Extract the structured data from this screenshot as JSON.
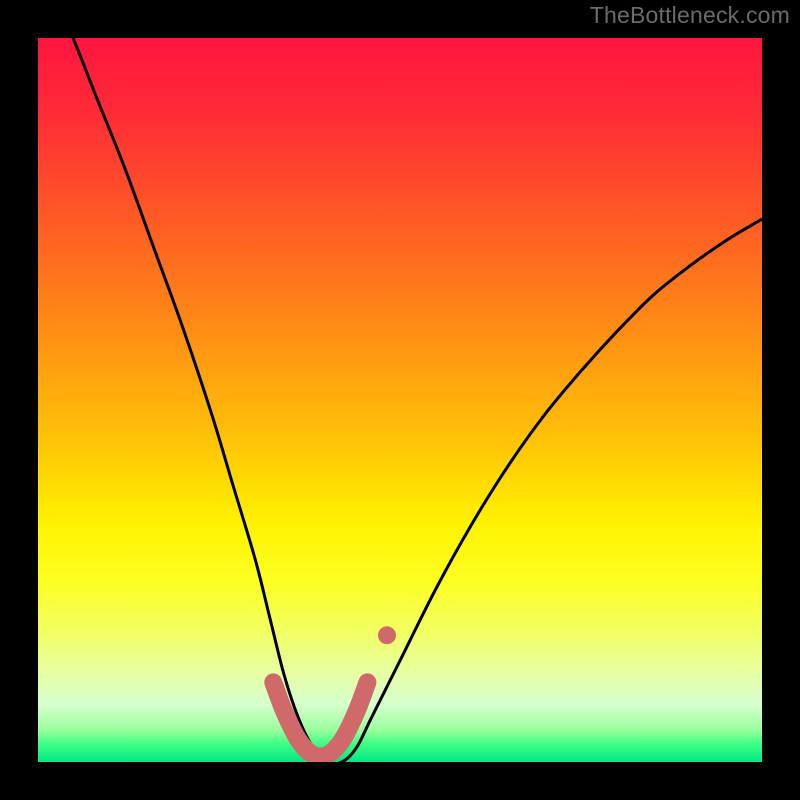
{
  "watermark": "TheBottleneck.com",
  "chart_data": {
    "type": "line",
    "title": "",
    "xlabel": "",
    "ylabel": "",
    "xlim": [
      0,
      100
    ],
    "ylim": [
      0,
      100
    ],
    "gradient_stops": [
      {
        "offset": 0.0,
        "color": "#ff153e"
      },
      {
        "offset": 0.1,
        "color": "#ff2a37"
      },
      {
        "offset": 0.25,
        "color": "#ff5a25"
      },
      {
        "offset": 0.4,
        "color": "#ff8c15"
      },
      {
        "offset": 0.55,
        "color": "#ffc108"
      },
      {
        "offset": 0.67,
        "color": "#fff200"
      },
      {
        "offset": 0.75,
        "color": "#fcff22"
      },
      {
        "offset": 0.82,
        "color": "#f2ff62"
      },
      {
        "offset": 0.88,
        "color": "#e6ffa6"
      },
      {
        "offset": 0.92,
        "color": "#d6ffce"
      },
      {
        "offset": 0.955,
        "color": "#9cff9e"
      },
      {
        "offset": 0.975,
        "color": "#3fff86"
      },
      {
        "offset": 1.0,
        "color": "#00e884"
      }
    ],
    "series": [
      {
        "name": "bottleneck-curve",
        "stroke": "#000000",
        "stroke_width": 3,
        "x": [
          0,
          4,
          8,
          12,
          16,
          20,
          24,
          27,
          30,
          32,
          34,
          36,
          38,
          40,
          42,
          44,
          46,
          50,
          55,
          60,
          65,
          70,
          75,
          80,
          85,
          90,
          95,
          100
        ],
        "y": [
          110,
          102,
          92,
          82,
          71,
          60,
          48,
          38,
          28,
          20,
          12,
          6,
          2,
          0,
          0,
          2,
          6,
          14,
          24,
          33,
          41,
          48,
          54,
          59.5,
          64.5,
          68.5,
          72,
          75
        ]
      },
      {
        "name": "highlight-band",
        "stroke": "#d06a6a",
        "stroke_width": 18,
        "linecap": "round",
        "x": [
          32.5,
          34,
          36,
          38,
          40,
          42,
          44,
          45.5
        ],
        "y": [
          11,
          7,
          3,
          1,
          1,
          3,
          7,
          11
        ]
      },
      {
        "name": "highlight-dot",
        "type": "scatter",
        "fill": "#d06a6a",
        "r": 9,
        "x": [
          48.2
        ],
        "y": [
          17.5
        ]
      }
    ]
  }
}
